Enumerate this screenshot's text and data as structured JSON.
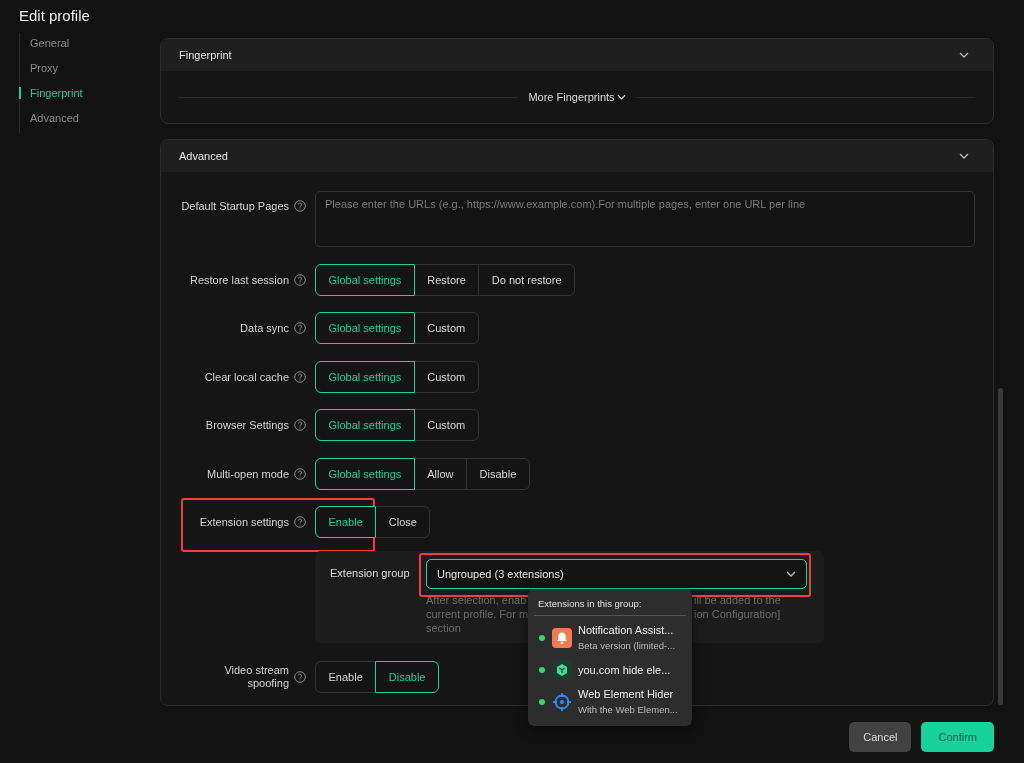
{
  "title": "Edit profile",
  "sidebar": {
    "items": [
      {
        "label": "General",
        "selected": false
      },
      {
        "label": "Proxy",
        "selected": false
      },
      {
        "label": "Fingerprint",
        "selected": true
      },
      {
        "label": "Advanced",
        "selected": false
      }
    ]
  },
  "fingerprint_section": {
    "title": "Fingerprint",
    "more_link": "More Fingerprints"
  },
  "advanced_section": {
    "title": "Advanced",
    "startup_pages": {
      "label": "Default Startup Pages",
      "placeholder": "Please enter the URLs (e.g., https://www.example.com).For multiple pages, enter one URL per line"
    },
    "settings": [
      {
        "label": "Restore last session",
        "highlighted": false,
        "options": [
          {
            "label": "Global settings",
            "selected": true
          },
          {
            "label": "Restore",
            "selected": false
          },
          {
            "label": "Do not restore",
            "selected": false
          }
        ]
      },
      {
        "label": "Data sync",
        "highlighted": false,
        "options": [
          {
            "label": "Global settings",
            "selected": true
          },
          {
            "label": "Custom",
            "selected": false
          }
        ]
      },
      {
        "label": "Clear local cache",
        "highlighted": false,
        "options": [
          {
            "label": "Global settings",
            "selected": true
          },
          {
            "label": "Custom",
            "selected": false
          }
        ]
      },
      {
        "label": "Browser Settings",
        "highlighted": false,
        "options": [
          {
            "label": "Global settings",
            "selected": true
          },
          {
            "label": "Custom",
            "selected": false
          }
        ]
      },
      {
        "label": "Multi-open mode",
        "highlighted": false,
        "options": [
          {
            "label": "Global settings",
            "selected": true
          },
          {
            "label": "Allow",
            "selected": false
          },
          {
            "label": "Disable",
            "selected": false
          }
        ]
      },
      {
        "label": "Extension settings",
        "highlighted": true,
        "options": [
          {
            "label": "Enable",
            "selected": true
          },
          {
            "label": "Close",
            "selected": false
          }
        ]
      }
    ],
    "extension_group": {
      "label": "Extension group",
      "value": "Ungrouped (3 extensions)",
      "highlighted": true,
      "hint_lines": [
        {
          "left": "After selection, enab",
          "right": "ill be added to the"
        },
        {
          "left": "current profile. For m",
          "right": "ion Configuration]"
        },
        {
          "left": "section"
        }
      ],
      "popup": {
        "title": "Extensions in this group:",
        "items": [
          {
            "kind": "bell",
            "name": "Notification Assist...",
            "description": "Beta version (limited-...",
            "enabled": true
          },
          {
            "kind": "cube",
            "name": "you.com hide ele...",
            "enabled": true
          },
          {
            "kind": "target",
            "name": "Web Element Hider",
            "description": "With the Web Elemen...",
            "enabled": true
          }
        ]
      }
    },
    "video_spoofing": {
      "label": "Video stream spoofing",
      "options": [
        {
          "label": "Enable",
          "selected": false
        },
        {
          "label": "Disable",
          "selected": true
        }
      ]
    }
  },
  "buttons": {
    "cancel": "Cancel",
    "confirm": "Confirm"
  }
}
